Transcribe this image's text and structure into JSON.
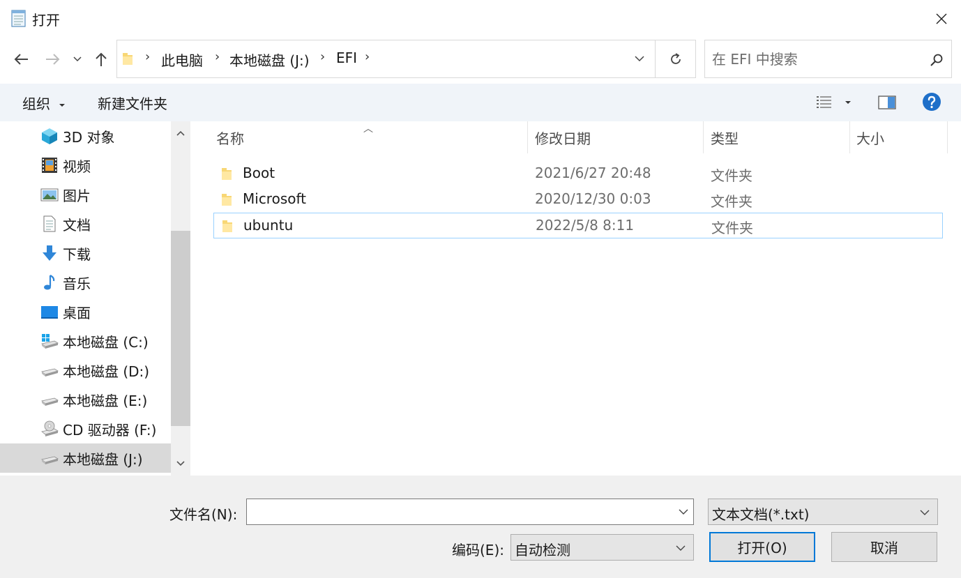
{
  "window": {
    "title": "打开"
  },
  "address": {
    "crumbs": [
      "此电脑",
      "本地磁盘 (J:)",
      "EFI"
    ],
    "search_placeholder": "在 EFI 中搜索"
  },
  "toolbar": {
    "organize_label": "组织",
    "new_folder_label": "新建文件夹"
  },
  "sidebar": {
    "items": [
      {
        "label": "3D 对象",
        "icon": "3d-objects-icon"
      },
      {
        "label": "视频",
        "icon": "video-icon"
      },
      {
        "label": "图片",
        "icon": "pictures-icon"
      },
      {
        "label": "文档",
        "icon": "documents-icon"
      },
      {
        "label": "下载",
        "icon": "download-icon"
      },
      {
        "label": "音乐",
        "icon": "music-icon"
      },
      {
        "label": "桌面",
        "icon": "desktop-icon"
      },
      {
        "label": "本地磁盘 (C:)",
        "icon": "system-drive-icon"
      },
      {
        "label": "本地磁盘 (D:)",
        "icon": "drive-icon"
      },
      {
        "label": "本地磁盘 (E:)",
        "icon": "drive-icon"
      },
      {
        "label": "CD 驱动器 (F:)",
        "icon": "cd-drive-icon"
      },
      {
        "label": "本地磁盘 (J:)",
        "icon": "drive-icon",
        "selected": true
      }
    ]
  },
  "columns": {
    "name": "名称",
    "modified": "修改日期",
    "type": "类型",
    "size": "大小"
  },
  "files": [
    {
      "name": "Boot",
      "modified": "2021/6/27 20:48",
      "type": "文件夹"
    },
    {
      "name": "Microsoft",
      "modified": "2020/12/30 0:03",
      "type": "文件夹"
    },
    {
      "name": "ubuntu",
      "modified": "2022/5/8 8:11",
      "type": "文件夹",
      "selected": true
    }
  ],
  "bottom": {
    "filename_label": "文件名(N):",
    "filename_value": "",
    "filetype_value": "文本文档(*.txt)",
    "encoding_label": "编码(E):",
    "encoding_value": "自动检测",
    "open_label": "打开(O)",
    "cancel_label": "取消"
  },
  "colors": {
    "accent": "#0078d7",
    "toolbar_bg": "#f0f4f9",
    "selection_border": "#99d1ff"
  }
}
